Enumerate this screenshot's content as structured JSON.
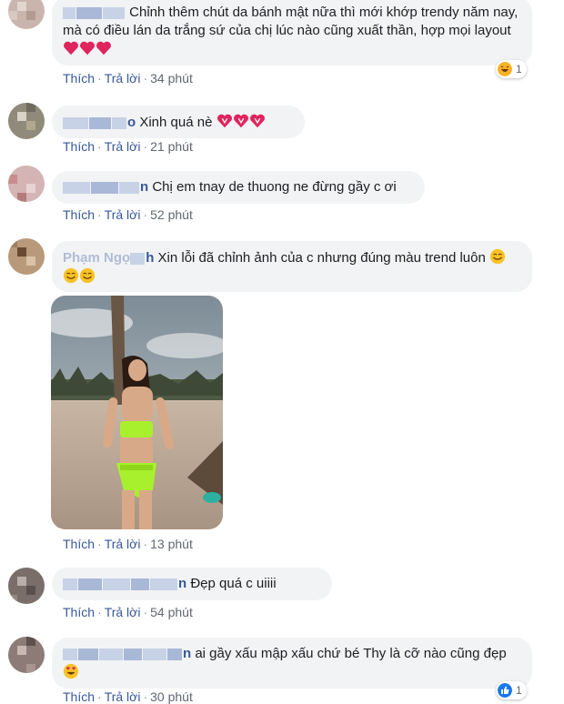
{
  "actions": {
    "like": "Thích",
    "reply": "Trả lời",
    "dot": "·"
  },
  "comments": [
    {
      "text": "Chỉnh thêm chút da bánh mật nữa thì mới khớp trendy năm nay, mà có điều lán da trắng sứ của chị lúc nào cũng xuất thần, hợp mọi layout",
      "time": "34 phút",
      "reaction": {
        "icon": "haha-icon",
        "count": "1"
      }
    },
    {
      "name_tail": "o",
      "text": "Xinh quá nè",
      "time": "21 phút"
    },
    {
      "name_tail": "n",
      "text": "Chị em tnay de thuong ne đừng gầy c ơi",
      "time": "52 phút"
    },
    {
      "name_tail": "h",
      "name_head": "Phạm Ngọ",
      "text": "Xin lỗi đã chỉnh ảnh của c nhưng đúng màu trend luôn",
      "time": "13 phút"
    },
    {
      "name_tail": "n",
      "text": "Đẹp quá c uiiii",
      "time": "54 phút"
    },
    {
      "name_tail": "n",
      "text": "ai gầy xấu mập xấu chứ bé Thy là cỡ nào cũng đẹp",
      "time": "30 phút",
      "reaction": {
        "icon": "like-icon",
        "count": "1"
      }
    }
  ],
  "colors": {
    "link": "#385898",
    "bubble": "#f2f3f5",
    "heart": "#e0245e",
    "bikini": "#a8f02e"
  }
}
